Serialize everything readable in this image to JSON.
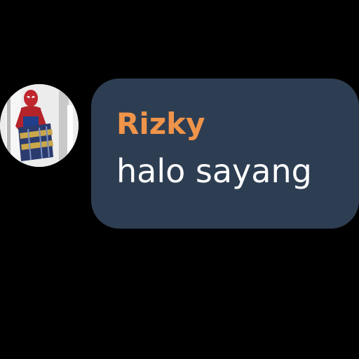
{
  "message": {
    "sender_name": "Rizky",
    "text": "halo sayang",
    "avatar_icon": "spiderman-avatar-icon",
    "colors": {
      "background": "#000000",
      "bubble": "#2e3e52",
      "sender_name": "#f0944a",
      "text": "#ffffff"
    }
  }
}
